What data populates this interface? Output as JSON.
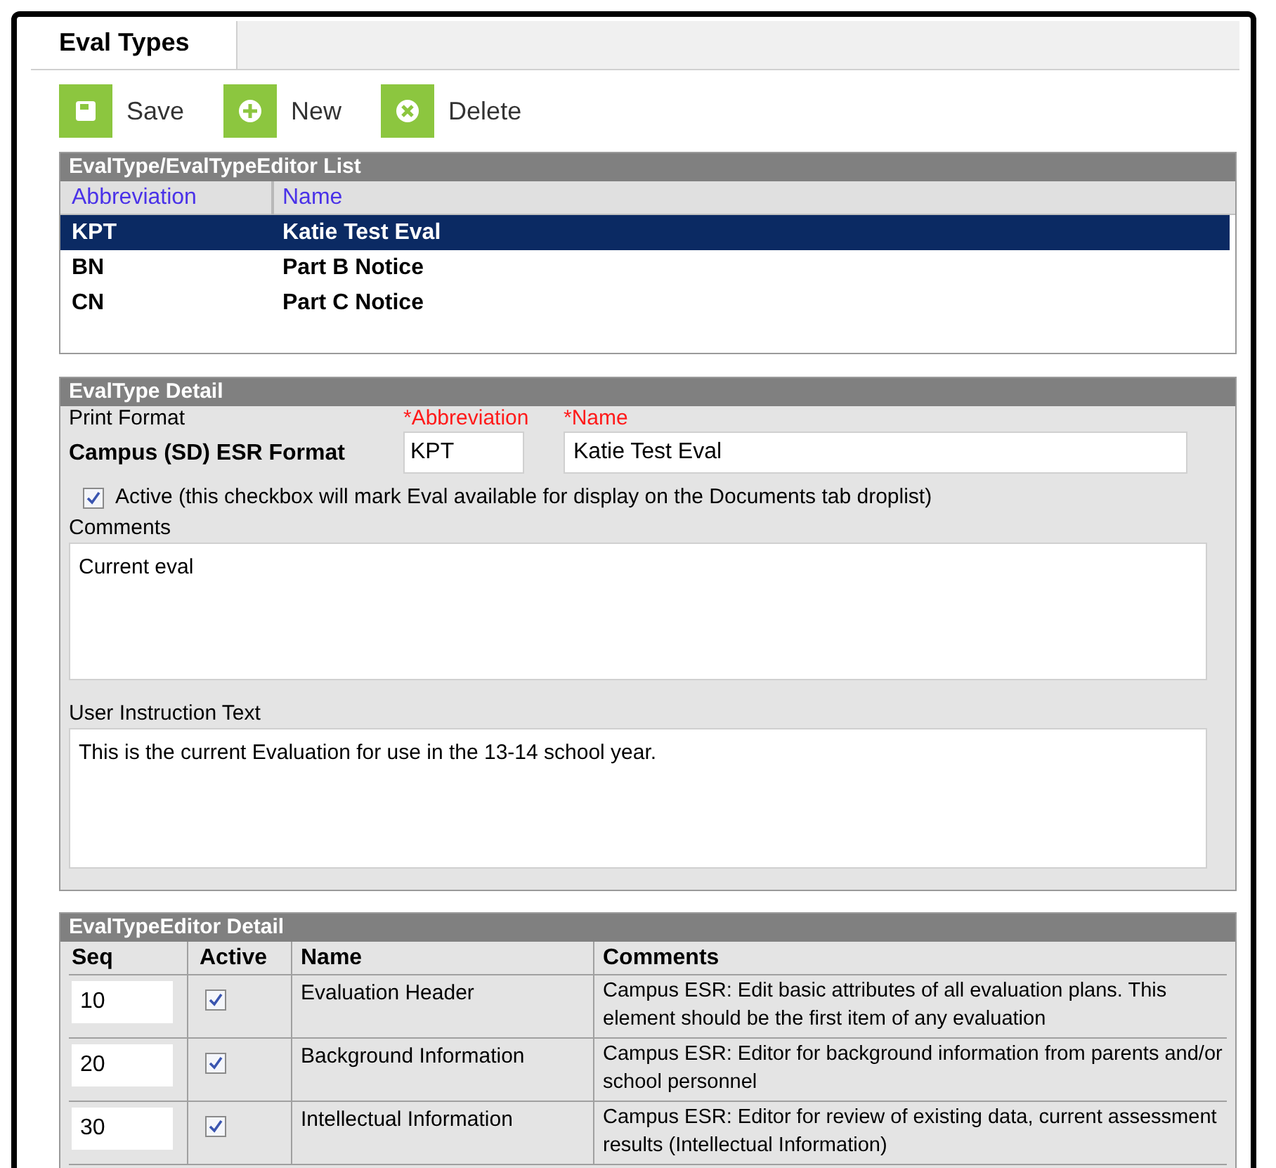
{
  "tabs": [
    {
      "label": "Eval Types",
      "selected": true
    }
  ],
  "toolbar": [
    {
      "kind": "save",
      "label": "Save"
    },
    {
      "kind": "new",
      "label": "New"
    },
    {
      "kind": "delete",
      "label": "Delete"
    }
  ],
  "list_panel": {
    "title": "EvalType/EvalTypeEditor List",
    "columns": [
      "Abbreviation",
      "Name"
    ],
    "rows": [
      {
        "abbreviation": "KPT",
        "name": "Katie Test Eval",
        "selected": true
      },
      {
        "abbreviation": "BN",
        "name": "Part B Notice",
        "selected": false
      },
      {
        "abbreviation": "CN",
        "name": "Part C Notice",
        "selected": false
      }
    ]
  },
  "detail_panel": {
    "title": "EvalType Detail",
    "print_format_label": "Print Format",
    "print_format_value": "Campus (SD) ESR Format",
    "abbreviation_label": "*Abbreviation",
    "abbreviation_value": "KPT",
    "name_label": "*Name",
    "name_value": "Katie Test Eval",
    "active_checked": true,
    "active_label": "Active (this checkbox will mark Eval available for display on the Documents tab droplist)",
    "comments_label": "Comments",
    "comments_value": "Current eval",
    "instruction_label": "User Instruction Text",
    "instruction_value": "This is the current Evaluation for use in the 13-14 school year."
  },
  "editor_panel": {
    "title": "EvalTypeEditor Detail",
    "columns": [
      "Seq",
      "Active",
      "Name",
      "Comments"
    ],
    "rows": [
      {
        "seq": "10",
        "active": true,
        "name": "Evaluation Header",
        "comments": "Campus ESR: Edit basic attributes of all evaluation plans. This element should be the first item of any evaluation"
      },
      {
        "seq": "20",
        "active": true,
        "name": "Background Information",
        "comments": "Campus ESR: Editor for background information from parents and/or school personnel"
      },
      {
        "seq": "30",
        "active": true,
        "name": "Intellectual Information",
        "comments": "Campus ESR: Editor for review of existing data, current assessment results (Intellectual Information)"
      }
    ]
  }
}
